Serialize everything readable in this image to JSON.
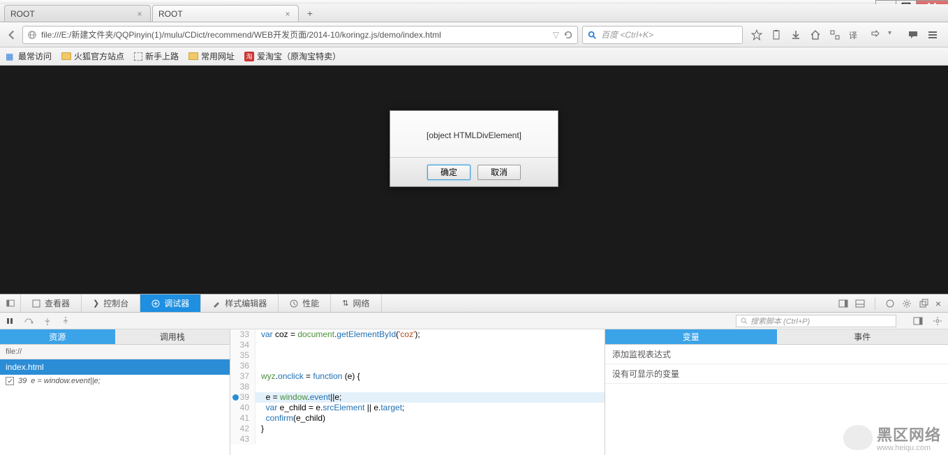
{
  "window": {
    "min": "—",
    "max": "□",
    "close": "X"
  },
  "tabs": [
    {
      "title": "ROOT",
      "active": false
    },
    {
      "title": "ROOT",
      "active": true
    }
  ],
  "url": "file:///E:/新建文件夹/QQPinyin(1)/mulu/CDict/recommend/WEB开发页面/2014-10/koringz.js/demo/index.html",
  "search_placeholder": "百度 <Ctrl+K>",
  "bookmarks": {
    "freq": "最常访问",
    "ff": "火狐官方站点",
    "novice": "新手上路",
    "common": "常用网址",
    "taobao_badge": "淘",
    "taobao": "爱淘宝（原淘宝特卖）"
  },
  "dialog": {
    "message": "[object HTMLDivElement]",
    "ok": "确定",
    "cancel": "取消"
  },
  "devtools": {
    "tabs": {
      "inspector": "查看器",
      "console": "控制台",
      "debugger": "调试器",
      "style": "样式编辑器",
      "perf": "性能",
      "network": "网络"
    },
    "search_placeholder": "搜索脚本 (Ctrl+P)",
    "left_tabs": {
      "sources": "资源",
      "callstack": "调用栈"
    },
    "file_host": "file://",
    "file_name": "index.html",
    "breakpoint": {
      "checked": true,
      "line": "39",
      "expr": "e = window.event||e;"
    },
    "right_tabs": {
      "vars": "变量",
      "events": "事件"
    },
    "watch": "添加监视表达式",
    "novars": "没有可显示的变量",
    "code": [
      {
        "n": 33,
        "html": "<span class='kw'>var</span> coz = <span class='obj'>document</span>.<span class='fn'>getElementById</span>(<span class='str'>'coz'</span>);"
      },
      {
        "n": 34,
        "html": ""
      },
      {
        "n": 35,
        "html": ""
      },
      {
        "n": 36,
        "html": ""
      },
      {
        "n": 37,
        "html": "<span class='obj'>wyz</span>.<span class='fn'>onclick</span> = <span class='kw'>function</span> (e) {"
      },
      {
        "n": 38,
        "html": ""
      },
      {
        "n": 39,
        "html": "  e = <span class='obj'>window</span>.<span class='fn'>event</span>||e;",
        "bp": true,
        "hl": true
      },
      {
        "n": 40,
        "html": "  <span class='kw'>var</span> e_child = e.<span class='fn'>srcElement</span> || e.<span class='fn'>target</span>;"
      },
      {
        "n": 41,
        "html": "  <span class='fn'>confirm</span>(e_child)"
      },
      {
        "n": 42,
        "html": "}"
      },
      {
        "n": 43,
        "html": ""
      }
    ]
  },
  "watermark": {
    "brand": "黑区网络",
    "url": "www.heiqu.com"
  }
}
